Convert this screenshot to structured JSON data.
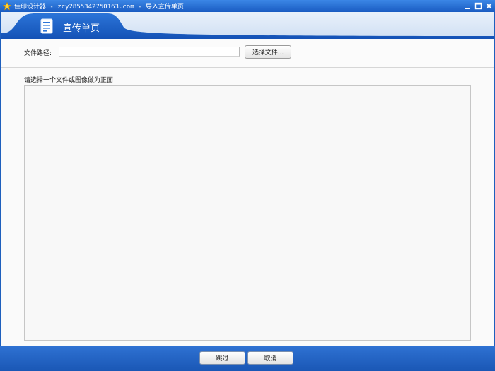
{
  "window": {
    "title": "佳印设计器 - zcy2855342750163.com - 导入宣传单页",
    "icons": {
      "app": "star-icon",
      "minimize": "minimize-icon",
      "maximize": "maximize-icon",
      "close": "close-icon"
    }
  },
  "header": {
    "tab_label": "宣传单页",
    "tab_icon": "document-icon"
  },
  "file_path": {
    "label": "文件路径:",
    "value": "",
    "placeholder": "",
    "choose_button": "选择文件..."
  },
  "main": {
    "prompt": "请选择一个文件或图像做为正面"
  },
  "footer": {
    "skip_button": "跳过",
    "cancel_button": "取消"
  },
  "colors": {
    "frame": "#1e5fbd",
    "header_tab": "#1f63c9",
    "background": "#fafafa"
  }
}
